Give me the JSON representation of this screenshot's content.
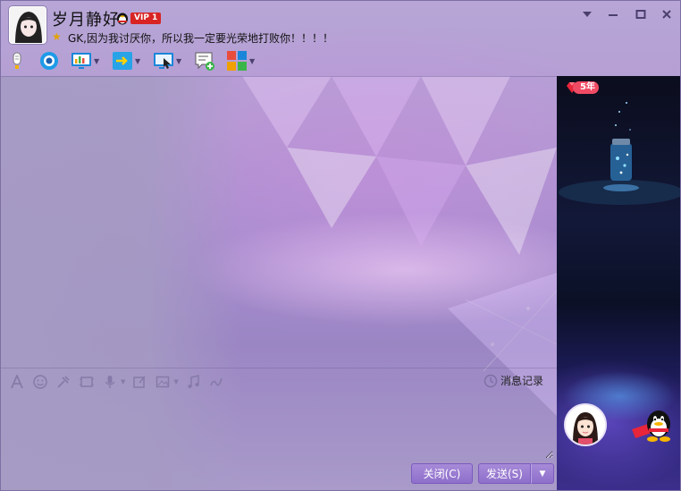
{
  "window": {
    "minimize_icon": "minimize-icon",
    "maximize_icon": "maximize-icon",
    "close_icon": "close-icon",
    "menu_icon": "dropdown-menu-icon"
  },
  "contact": {
    "nickname": "岁月静好",
    "vip_label": "VIP 1",
    "signature": "GK,因为我讨厌你，所以我一定要光荣地打败你！！！！"
  },
  "toolbar": {
    "items": [
      {
        "name": "voice-call",
        "icon": "microphone-icon",
        "has_menu": false
      },
      {
        "name": "video-call",
        "icon": "camera-icon",
        "has_menu": false
      },
      {
        "name": "screen-share",
        "icon": "remote-assist-icon",
        "has_menu": true
      },
      {
        "name": "send-file",
        "icon": "file-transfer-icon",
        "has_menu": true
      },
      {
        "name": "remote-desktop",
        "icon": "remote-desktop-icon",
        "has_menu": true
      },
      {
        "name": "create-discussion",
        "icon": "add-chat-icon",
        "has_menu": false
      },
      {
        "name": "apps",
        "icon": "apps-grid-icon",
        "has_menu": true
      }
    ]
  },
  "side_panel": {
    "years_badge": "5年"
  },
  "input_toolbar": {
    "items": [
      "font-icon",
      "emoji-icon",
      "shake-icon",
      "video-message-icon",
      "voice-message-icon",
      "screenshot-icon",
      "image-icon",
      "music-icon",
      "doodle-icon"
    ]
  },
  "history_label": "消息记录",
  "buttons": {
    "close_label": "关闭(C)",
    "send_label": "发送(S)"
  },
  "colors": {
    "accent": "#8e6fcb",
    "vip_red": "#d92424",
    "years_pink": "#f04b64"
  }
}
